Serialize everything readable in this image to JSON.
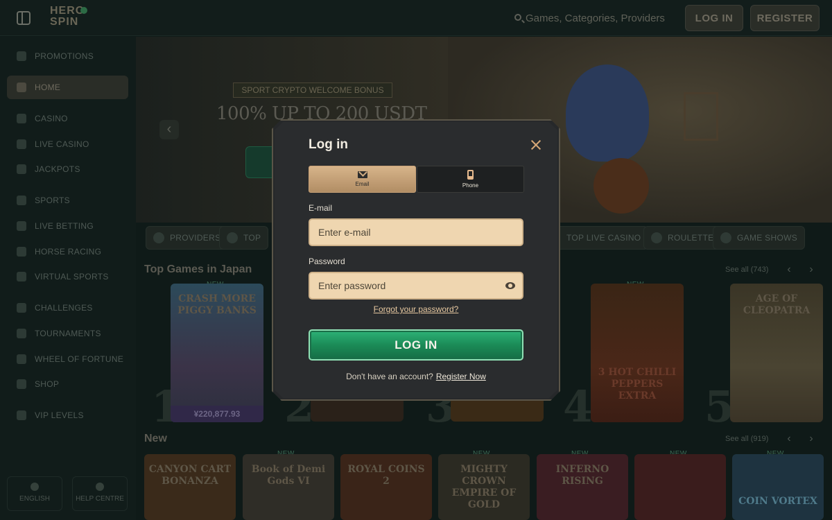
{
  "header": {
    "logo_line1": "HERO",
    "logo_line2": "SPIN",
    "search_placeholder": "Games, Categories, Providers",
    "login_label": "LOG IN",
    "register_label": "REGISTER"
  },
  "sidebar": {
    "items": [
      {
        "label": "PROMOTIONS",
        "icon": "gift-icon"
      },
      {
        "label": "HOME",
        "icon": "home-icon",
        "active": true
      },
      {
        "label": "CASINO",
        "icon": "cards-icon"
      },
      {
        "label": "LIVE CASINO",
        "icon": "live-icon"
      },
      {
        "label": "JACKPOTS",
        "icon": "coins-icon"
      },
      {
        "label": "SPORTS",
        "icon": "ball-icon"
      },
      {
        "label": "LIVE BETTING",
        "icon": "live-bet-icon"
      },
      {
        "label": "HORSE RACING",
        "icon": "horse-icon"
      },
      {
        "label": "VIRTUAL SPORTS",
        "icon": "virtual-icon"
      },
      {
        "label": "CHALLENGES",
        "icon": "target-icon"
      },
      {
        "label": "TOURNAMENTS",
        "icon": "trophy-icon"
      },
      {
        "label": "WHEEL OF FORTUNE",
        "icon": "wheel-icon"
      },
      {
        "label": "SHOP",
        "icon": "shop-icon"
      },
      {
        "label": "VIP LEVELS",
        "icon": "crown-icon"
      }
    ],
    "footer": {
      "language": "ENGLISH",
      "help": "HELP CENTRE"
    }
  },
  "banner": {
    "tag": "SPORT CRYPTO WELCOME BONUS",
    "title": "100% UP TO 200 USDT"
  },
  "chips": [
    "PROVIDERS",
    "TOP",
    "TOP LIVE CASINO",
    "ROULETTE",
    "GAME SHOWS"
  ],
  "top_games": {
    "title": "Top Games in Japan",
    "see_all": "See all (743)",
    "ranks": [
      "1",
      "2",
      "3",
      "4",
      "5"
    ],
    "cards": [
      {
        "title": "CRASH MORE PIGGY BANKS",
        "badge": "NEW",
        "price": "¥220,877.93"
      },
      {
        "title": "3 HOT CHILLI PEPPERS EXTRA",
        "badge": "NEW"
      },
      {
        "title": "AGE OF CLEOPATRA",
        "badge": ""
      }
    ]
  },
  "new_games": {
    "title": "New",
    "see_all": "See all (919)",
    "cards": [
      {
        "title": "CANYON CART BONANZA",
        "badge": ""
      },
      {
        "title": "Book of Demi Gods VI",
        "badge": "NEW"
      },
      {
        "title": "ROYAL COINS 2",
        "badge": ""
      },
      {
        "title": "MIGHTY CROWN EMPIRE OF GOLD",
        "badge": "NEW"
      },
      {
        "title": "INFERNO RISING",
        "badge": "NEW"
      },
      {
        "title": "",
        "badge": "NEW"
      },
      {
        "title": "COIN VORTEX",
        "badge": "NEW"
      }
    ]
  },
  "modal": {
    "title": "Log in",
    "tabs": [
      {
        "label": "Email",
        "icon": "envelope-icon",
        "active": true
      },
      {
        "label": "Phone",
        "icon": "phone-icon",
        "active": false
      }
    ],
    "email_label": "E-mail",
    "email_placeholder": "Enter e-mail",
    "password_label": "Password",
    "password_placeholder": "Enter password",
    "forgot": "Forgot your password?",
    "submit": "LOG IN",
    "no_account": "Don't have an account?",
    "register_link": "Register Now"
  },
  "colors": {
    "accent_green": "#1b8b57",
    "tab_gold": "#d7b48a",
    "input_bg": "#efd6b0",
    "modal_bg": "#2a2c2e"
  }
}
